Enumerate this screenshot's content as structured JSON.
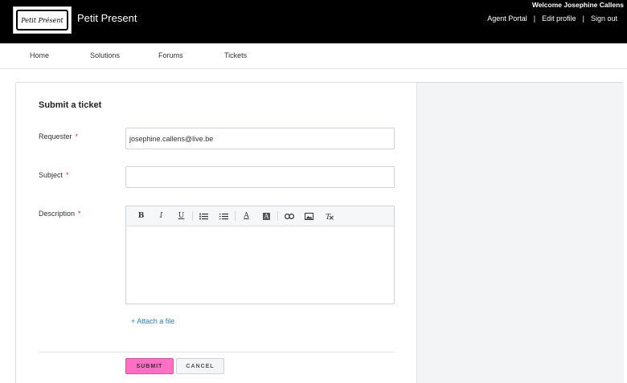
{
  "header": {
    "logo_text": "Petit Présent",
    "site_name": "Petit Present",
    "welcome": "Welcome Josephine Callens",
    "links": [
      "Agent Portal",
      "Edit profile",
      "Sign out"
    ],
    "separator": "|"
  },
  "nav": {
    "items": [
      "Home",
      "Solutions",
      "Forums",
      "Tickets"
    ]
  },
  "form": {
    "title": "Submit a ticket",
    "required_mark": "*",
    "requester": {
      "label": "Requester",
      "value": "josephine.callens@live.be"
    },
    "subject": {
      "label": "Subject",
      "value": ""
    },
    "description": {
      "label": "Description",
      "toolbar": [
        "B",
        "I",
        "U",
        "bullet-list",
        "numbered-list",
        "A",
        "A",
        "link",
        "image",
        "clear-format"
      ]
    },
    "attach_label": "+ Attach a file",
    "submit_label": "SUBMIT",
    "cancel_label": "CANCEL"
  },
  "colors": {
    "header_bg": "#000000",
    "submit_bg": "#ff6fc4",
    "link": "#2a7dd1",
    "required": "#e03030"
  }
}
